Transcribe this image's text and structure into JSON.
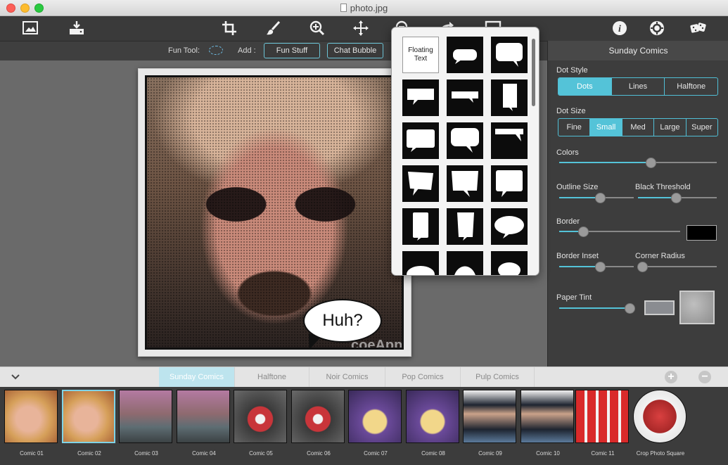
{
  "window": {
    "title": "photo.jpg"
  },
  "toolbar": {
    "left_icons": [
      "photo-icon",
      "save-tray-icon"
    ],
    "center_icons": [
      "crop-icon",
      "brush-icon",
      "zoom-in-icon",
      "move-icon",
      "zoom-out-icon",
      "redo-icon",
      "frame-icon"
    ],
    "right_icons": [
      "info-icon",
      "settings-icon",
      "dice-icon"
    ]
  },
  "subbar": {
    "fun_tool_label": "Fun Tool:",
    "add_label": "Add :",
    "fun_stuff": "Fun Stuff",
    "chat_bubble": "Chat Bubble"
  },
  "canvas": {
    "bubble_text": "Huh?",
    "watermark": "coeApp"
  },
  "popover": {
    "floating_text": "Floating Text",
    "bubble_count": 18
  },
  "panel": {
    "title": "Sunday Comics",
    "dot_style": {
      "label": "Dot Style",
      "options": [
        "Dots",
        "Lines",
        "Halftone"
      ],
      "selected": "Dots"
    },
    "dot_size": {
      "label": "Dot Size",
      "options": [
        "Fine",
        "Small",
        "Med",
        "Large",
        "Super"
      ],
      "selected": "Small"
    },
    "colors": {
      "label": "Colors",
      "value": 0.58
    },
    "outline_size": {
      "label": "Outline Size",
      "value": 0.55
    },
    "black_threshold": {
      "label": "Black Threshold",
      "value": 0.48
    },
    "border": {
      "label": "Border",
      "value": 0.2,
      "color": "#000000"
    },
    "border_inset": {
      "label": "Border Inset",
      "value": 0.55
    },
    "corner_radius": {
      "label": "Corner Radius",
      "value": 0.05
    },
    "paper_tint": {
      "label": "Paper Tint",
      "value": 1.0,
      "color": "#8a8c91"
    },
    "accent": "#54c3d8"
  },
  "tabs": {
    "items": [
      "Sunday Comics",
      "Halftone",
      "Noir Comics",
      "Pop Comics",
      "Pulp Comics"
    ],
    "active": "Sunday Comics"
  },
  "presets": [
    {
      "label": "Comic 01"
    },
    {
      "label": "Comic 02",
      "selected": true
    },
    {
      "label": "Comic 03"
    },
    {
      "label": "Comic 04"
    },
    {
      "label": "Comic 05"
    },
    {
      "label": "Comic 06"
    },
    {
      "label": "Comic 07"
    },
    {
      "label": "Comic 08"
    },
    {
      "label": "Comic 09"
    },
    {
      "label": "Comic 10"
    },
    {
      "label": "Comic 11"
    },
    {
      "label": "Crop Photo Square"
    }
  ]
}
